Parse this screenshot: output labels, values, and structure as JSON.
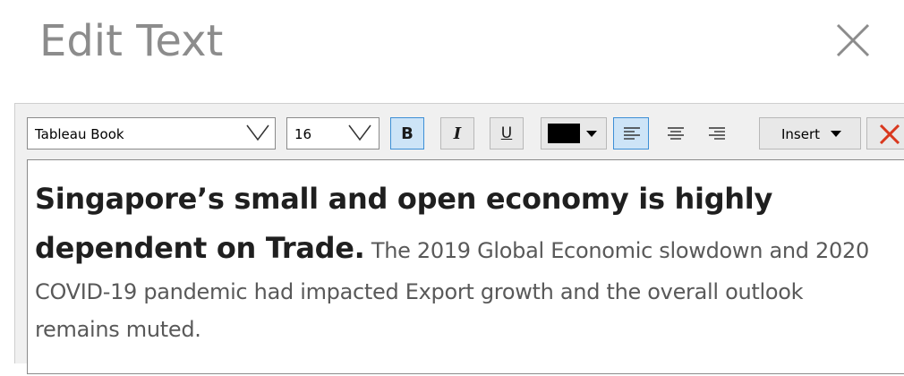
{
  "dialog": {
    "title": "Edit Text",
    "close_icon": "close-icon"
  },
  "toolbar": {
    "font_family": "Tableau Book",
    "font_size": "16",
    "bold_label": "B",
    "italic_label": "I",
    "underline_label": "U",
    "bold_active": true,
    "text_color": "#000000",
    "align_left_active": true,
    "insert_label": "Insert",
    "clear_icon": "clear-formatting-icon",
    "clear_color": "#d9381e"
  },
  "editor": {
    "bold_text": "Singapore’s small and open economy is highly dependent on Trade.",
    "body_text": " The 2019 Global Economic slowdown and 2020 COVID-19 pandemic had impacted Export growth and the overall outlook remains muted."
  }
}
